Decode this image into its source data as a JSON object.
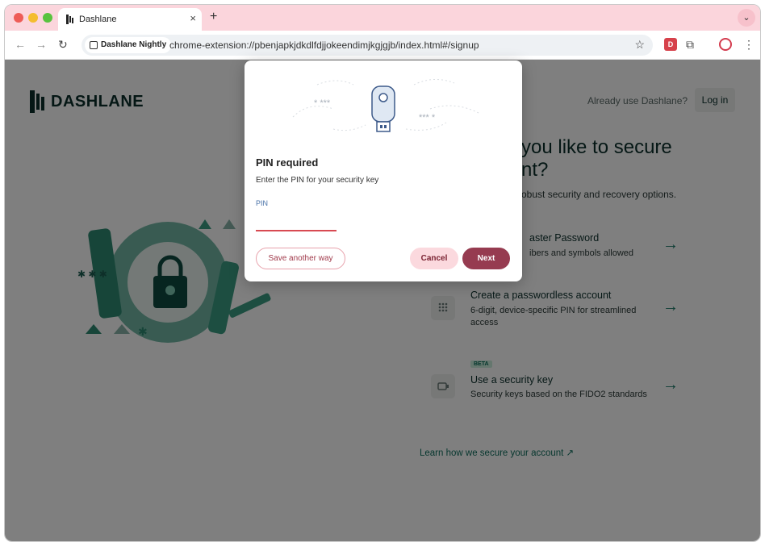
{
  "browser": {
    "tab_title": "Dashlane",
    "new_tab": "+",
    "tab_close": "×",
    "tab_menu": "⌄",
    "chip_label": "Dashlane Nightly",
    "url": "chrome-extension://pbenjapkjdkdlfdjjokeendimjkgjgjb/index.html#/signup",
    "icons": {
      "back": "back-arrow-icon",
      "forward": "forward-arrow-icon",
      "reload": "reload-icon",
      "star": "star-icon",
      "extension": "dashlane-extension-icon",
      "puzzle": "puzzle-icon",
      "profile": "profile-icon",
      "menu": "kebab-menu-icon"
    }
  },
  "page": {
    "logo_text": "DASHLANE",
    "already_text": "Already use Dashlane?",
    "login_label": "Log in",
    "heading_line1": "you like to secure",
    "heading_line2": "nt?",
    "subheading": "obust security and recovery options.",
    "options": [
      {
        "title": "aster Password",
        "desc": "ibers and symbols allowed"
      },
      {
        "title": "Create a passwordless account",
        "desc": "6-digit, device-specific PIN for streamlined access"
      },
      {
        "badge": "BETA",
        "title": "Use a security key",
        "desc": "Security keys based on the FIDO2 standards"
      }
    ],
    "learn_link": "Learn how we secure your account ↗"
  },
  "modal": {
    "title": "PIN required",
    "description": "Enter the PIN for your security key",
    "pin_label": "PIN",
    "pin_value": "",
    "save_label": "Save another way",
    "cancel_label": "Cancel",
    "next_label": "Next",
    "art_masks": [
      "* ***",
      "*** *"
    ]
  },
  "colors": {
    "tab_strip": "#fbd5dc",
    "brand_teal": "#0a2e2b",
    "accent_link": "#0f6f5e",
    "next_button": "#963b50",
    "cancel_button": "#fbd9de",
    "pin_underline": "#d84a52"
  }
}
